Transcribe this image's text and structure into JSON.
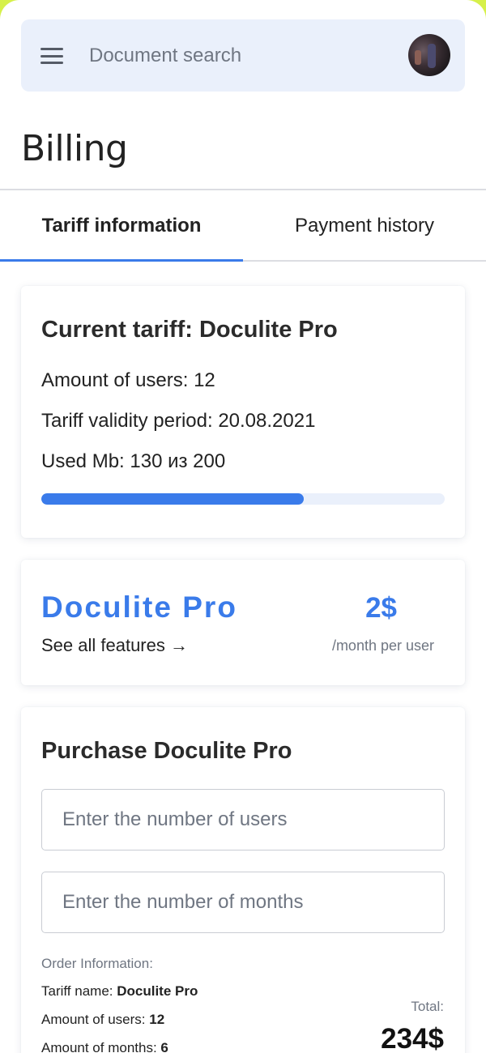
{
  "header": {
    "search_placeholder": "Document search",
    "menu_icon": "hamburger-menu-icon",
    "avatar_icon": "user-avatar"
  },
  "page": {
    "title": "Billing"
  },
  "tabs": [
    {
      "label": "Tariff information",
      "active": true
    },
    {
      "label": "Payment history",
      "active": false
    }
  ],
  "current_tariff": {
    "title": "Current tariff: Doculite Pro",
    "users_line": "Amount of users: 12",
    "validity_line": "Tariff validity period: 20.08.2021",
    "used_line": "Used Mb: 130 из 200",
    "used_mb": 130,
    "total_mb": 200
  },
  "plan": {
    "name": "Doculite Pro",
    "features_link": "See all features →",
    "price": "2$",
    "price_unit": "/month per user"
  },
  "purchase": {
    "title": "Purchase Doculite Pro",
    "users_placeholder": "Enter the number of users",
    "months_placeholder": "Enter the number of months",
    "order_heading": "Order Information:",
    "tariff_label": "Tariff name: ",
    "tariff_value": "Doculite Pro",
    "users_label": "Amount of users: ",
    "users_value": "12",
    "months_label": "Amount of months: ",
    "months_value": "6",
    "total_label": "Total:",
    "total_value": "234$"
  },
  "colors": {
    "accent": "#3a7bea",
    "search_bg": "#eaf0fb",
    "muted_text": "#6f7682"
  }
}
